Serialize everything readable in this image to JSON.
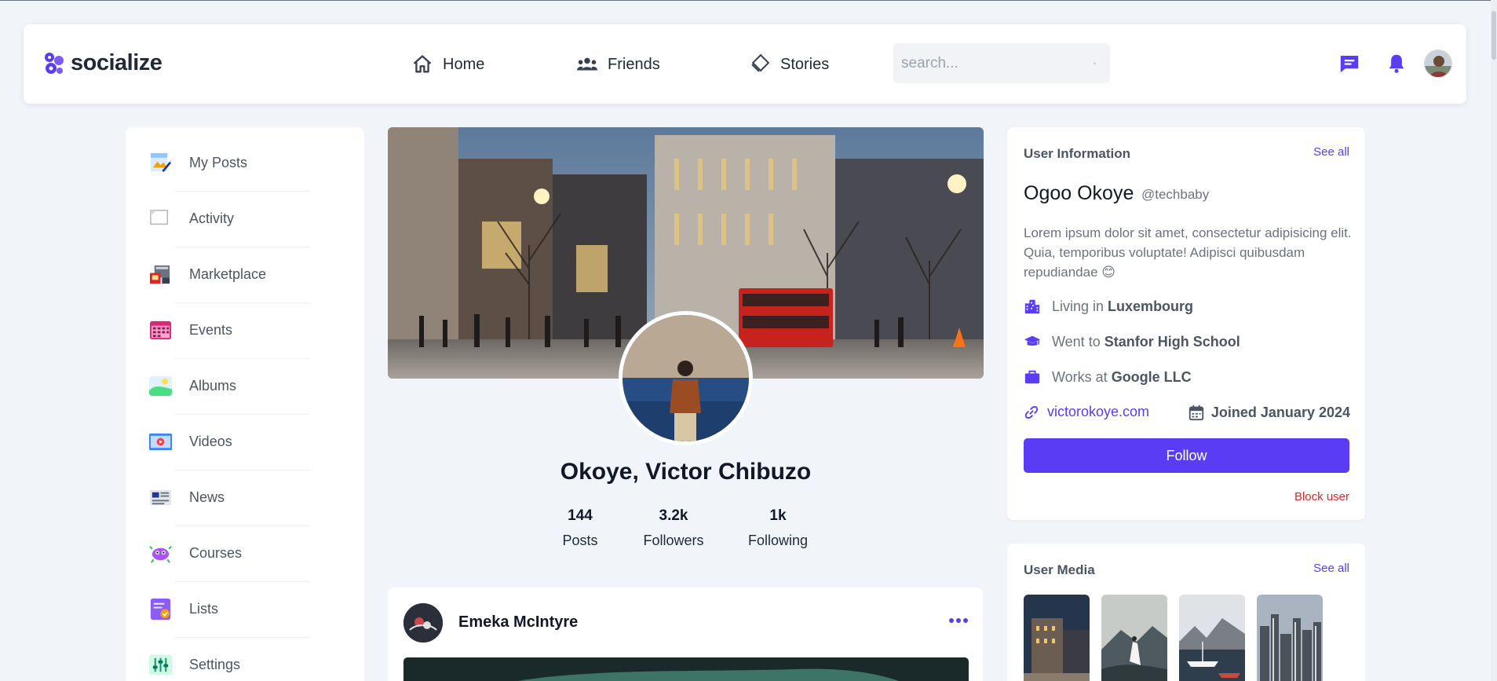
{
  "brand": {
    "name": "socialize",
    "accent": "#5b3cf5"
  },
  "nav": {
    "links": [
      {
        "label": "Home",
        "icon": "home-icon"
      },
      {
        "label": "Friends",
        "icon": "friends-icon"
      },
      {
        "label": "Stories",
        "icon": "stories-icon"
      }
    ],
    "search_placeholder": "search...",
    "icons": [
      "messages-icon",
      "notifications-bell-icon",
      "user-avatar"
    ]
  },
  "sidebar": {
    "items": [
      {
        "label": "My Posts",
        "icon": "my-posts-icon"
      },
      {
        "label": "Activity",
        "icon": "activity-icon"
      },
      {
        "label": "Marketplace",
        "icon": "marketplace-icon"
      },
      {
        "label": "Events",
        "icon": "events-calendar-icon"
      },
      {
        "label": "Albums",
        "icon": "albums-icon"
      },
      {
        "label": "Videos",
        "icon": "videos-icon"
      },
      {
        "label": "News",
        "icon": "news-icon"
      },
      {
        "label": "Courses",
        "icon": "courses-icon"
      },
      {
        "label": "Lists",
        "icon": "lists-icon"
      },
      {
        "label": "Settings",
        "icon": "settings-icon"
      }
    ]
  },
  "profile": {
    "name": "Okoye, Victor Chibuzo",
    "stats": [
      {
        "value": "144",
        "label": "Posts"
      },
      {
        "value": "3.2k",
        "label": "Followers"
      },
      {
        "value": "1k",
        "label": "Following"
      }
    ]
  },
  "post": {
    "author": "Emeka McIntyre"
  },
  "user_info": {
    "heading": "User Information",
    "see_all": "See all",
    "name": "Ogoo Okoye",
    "handle": "@techbaby",
    "bio": "Lorem ipsum dolor sit amet, consectetur adipisicing elit. Quia, temporibus voluptate! Adipisci quibusdam repudiandae 😊",
    "living_prefix": "Living in",
    "living_value": "Luxembourg",
    "school_prefix": "Went to",
    "school_value": "Stanfor High School",
    "work_prefix": "Works at",
    "work_value": "Google LLC",
    "website": "victorokoye.com",
    "joined": "Joined January 2024",
    "follow_label": "Follow",
    "block_label": "Block user"
  },
  "user_media": {
    "heading": "User Media",
    "see_all": "See all",
    "items": [
      "city-night-photo",
      "dancer-photo",
      "harbor-photo",
      "skyline-photo"
    ]
  }
}
